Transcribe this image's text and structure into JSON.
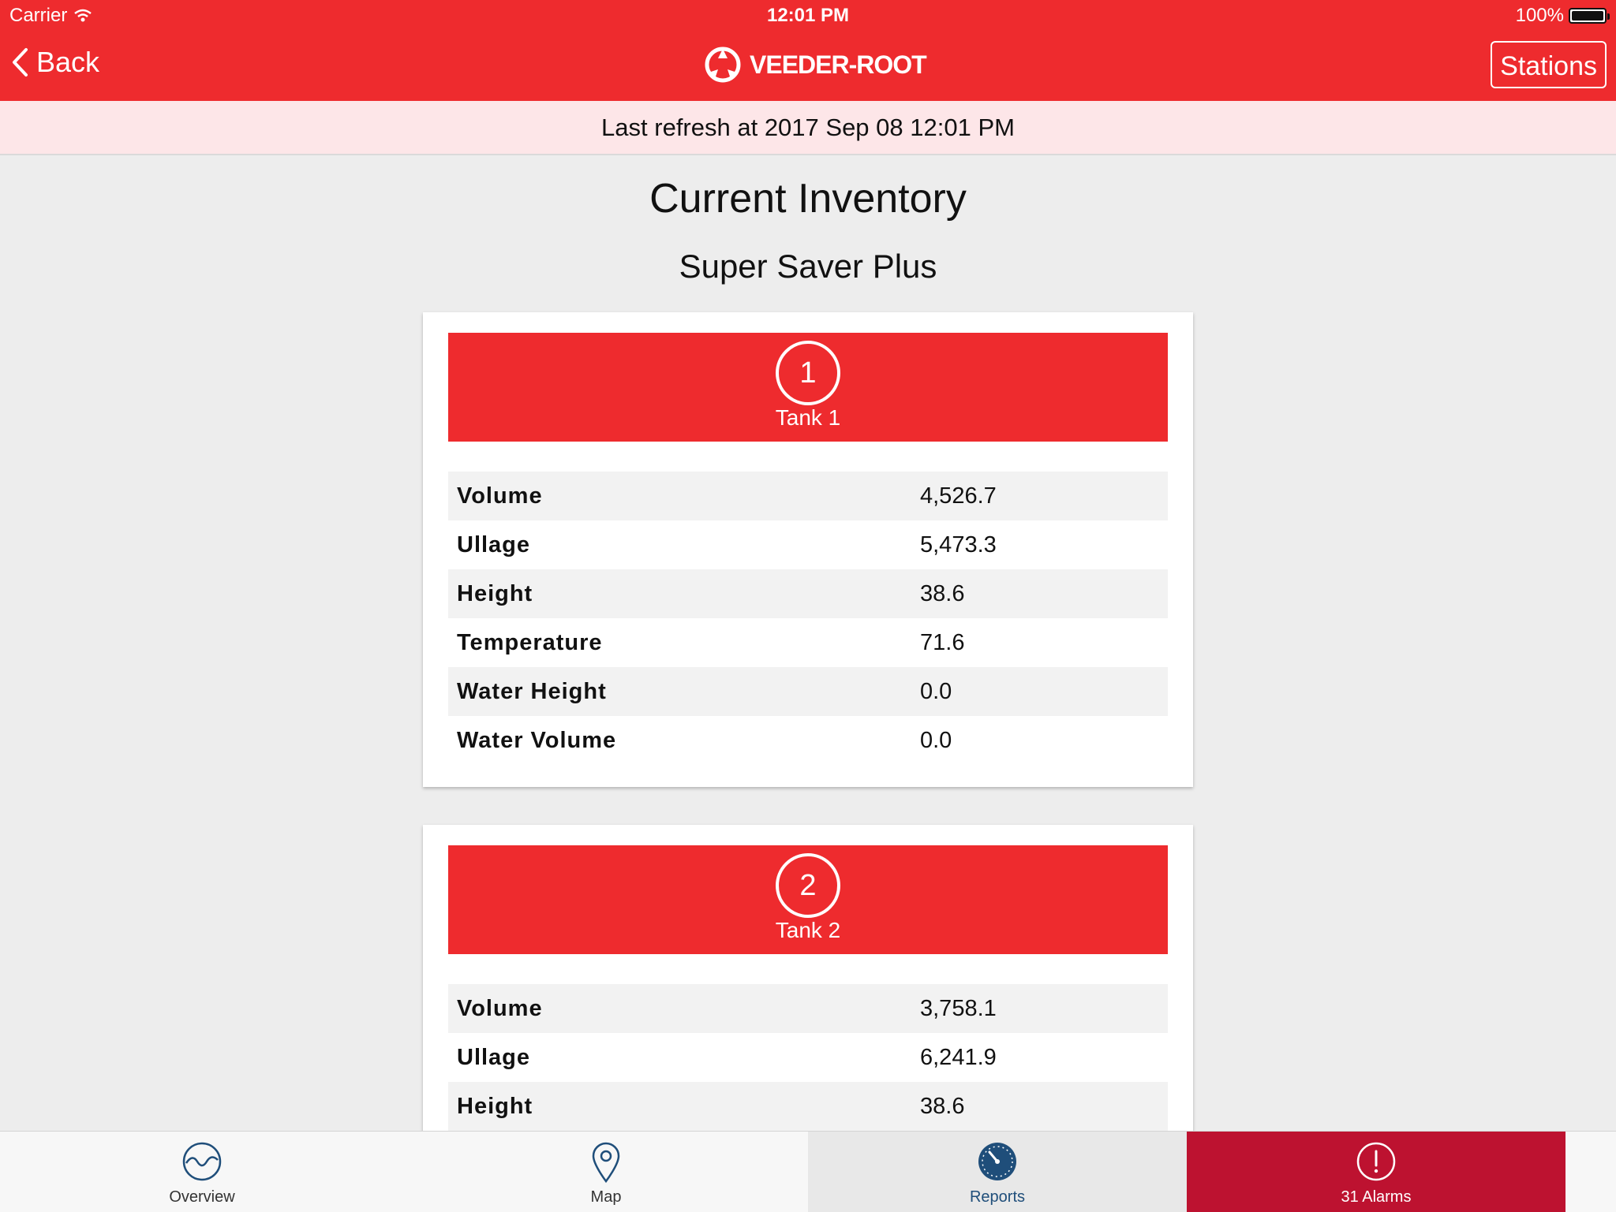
{
  "status_bar": {
    "carrier": "Carrier",
    "time": "12:01 PM",
    "battery": "100%"
  },
  "nav": {
    "back_label": "Back",
    "logo_text": "VEEDER-ROOT",
    "stations_label": "Stations"
  },
  "refresh_text": "Last refresh at 2017 Sep 08 12:01 PM",
  "page": {
    "title": "Current Inventory",
    "station": "Super Saver Plus"
  },
  "tanks": [
    {
      "number": "1",
      "name": "Tank 1",
      "rows": [
        {
          "label": "Volume",
          "value": "4,526.7"
        },
        {
          "label": "Ullage",
          "value": "5,473.3"
        },
        {
          "label": "Height",
          "value": "38.6"
        },
        {
          "label": "Temperature",
          "value": "71.6"
        },
        {
          "label": "Water Height",
          "value": "0.0"
        },
        {
          "label": "Water Volume",
          "value": "0.0"
        }
      ]
    },
    {
      "number": "2",
      "name": "Tank 2",
      "rows": [
        {
          "label": "Volume",
          "value": "3,758.1"
        },
        {
          "label": "Ullage",
          "value": "6,241.9"
        },
        {
          "label": "Height",
          "value": "38.6"
        }
      ]
    }
  ],
  "tabbar": {
    "overview": "Overview",
    "map": "Map",
    "reports": "Reports",
    "alarms": "31 Alarms"
  },
  "colors": {
    "brand_red": "#ee2b2e",
    "alarm_red": "#bd1230",
    "tab_active": "#1f4e7a",
    "refresh_bg": "#fde6e8"
  },
  "icons": [
    "wifi-icon",
    "battery-icon",
    "back-chevron-icon",
    "veeder-root-logo-icon",
    "overview-wave-icon",
    "map-pin-icon",
    "reports-gauge-icon",
    "alarm-exclamation-icon"
  ]
}
